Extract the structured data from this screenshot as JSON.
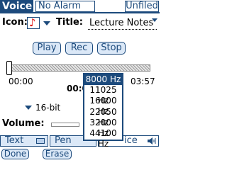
{
  "header": {
    "app_title": "Voice",
    "alarm_label": "No Alarm",
    "category_label": "Unfiled"
  },
  "form": {
    "icon_label": "Icon:",
    "icon_glyph": "♪",
    "title_label": "Title:",
    "title_value": "Lecture Notes"
  },
  "playback": {
    "play_label": "Play",
    "rec_label": "Rec",
    "stop_label": "Stop"
  },
  "timeline": {
    "position": 0.0,
    "start_time": "00:00",
    "current_time": "00:0",
    "end_time": "03:57"
  },
  "settings": {
    "bit_depth_label": "16-bit",
    "volume_label": "Volume:"
  },
  "sample_rate_menu": {
    "selected": "8000 Hz",
    "options": [
      "8000 Hz",
      "11025 Hz",
      "16000 Hz",
      "22050 Hz",
      "32000 Hz",
      "44100 Hz"
    ]
  },
  "tabs": {
    "text_label": "Text",
    "pen_label": "Pen",
    "voice_label": "ice"
  },
  "bottom": {
    "done_label": "Done",
    "erase_label": "Erase"
  },
  "colors": {
    "accent": "#1c4a7c",
    "button_fill": "#dbe8f7",
    "icon_red": "#d11"
  }
}
